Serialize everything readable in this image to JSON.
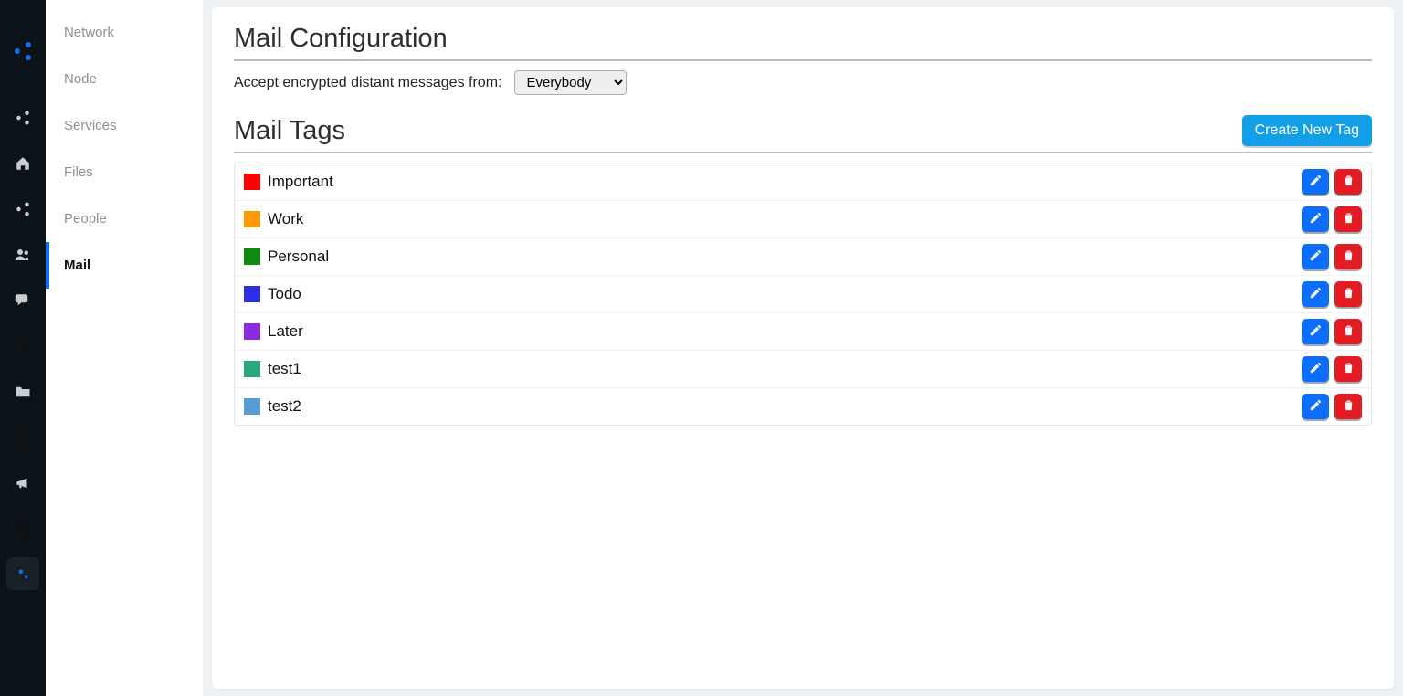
{
  "rail_icons": [
    "share-nodes",
    "home",
    "share",
    "users",
    "chat",
    "envelope",
    "folder",
    "monitor",
    "bullhorn",
    "globe"
  ],
  "rail_active_icon": "gears",
  "sidebar": {
    "items": [
      "Network",
      "Node",
      "Services",
      "Files",
      "People",
      "Mail"
    ],
    "active_index": 5
  },
  "page": {
    "title_config": "Mail Configuration",
    "accept_label": "Accept encrypted distant messages from:",
    "accept_value": "Everybody",
    "accept_options": [
      "Everybody"
    ],
    "title_tags": "Mail Tags",
    "create_button": "Create New Tag"
  },
  "tags": [
    {
      "name": "Important",
      "color": "#ff0000"
    },
    {
      "name": "Work",
      "color": "#ff9900"
    },
    {
      "name": "Personal",
      "color": "#0f8b0f"
    },
    {
      "name": "Todo",
      "color": "#2e2ee6"
    },
    {
      "name": "Later",
      "color": "#8a2be2"
    },
    {
      "name": "test1",
      "color": "#2aa87d"
    },
    {
      "name": "test2",
      "color": "#5b9bd5"
    }
  ]
}
